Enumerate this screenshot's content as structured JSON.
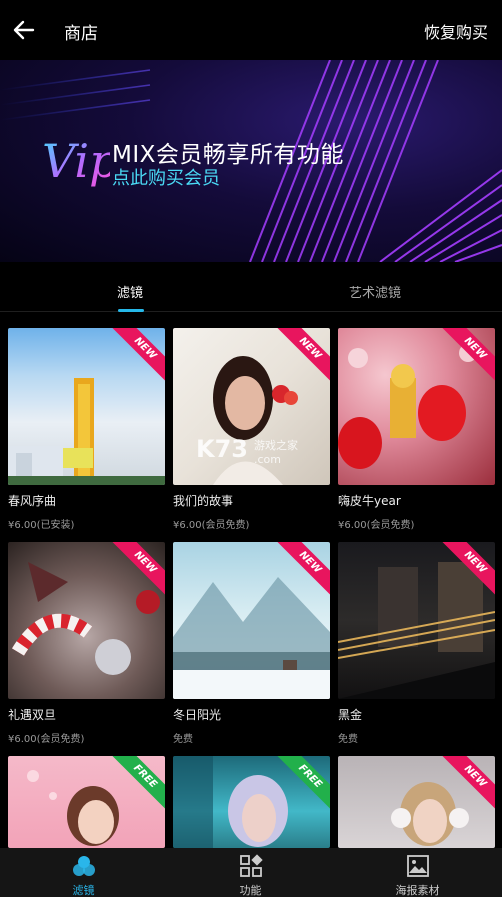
{
  "header": {
    "title": "商店",
    "restore_label": "恢复购买"
  },
  "banner": {
    "logo_text": "Vip",
    "line1": "MIX会员畅享所有功能",
    "line2": "点此购买会员"
  },
  "tabs": [
    {
      "label": "滤镜",
      "active": true
    },
    {
      "label": "艺术滤镜",
      "active": false
    }
  ],
  "items": [
    {
      "name": "春风序曲",
      "price": "¥6.00(已安装)",
      "badge": "NEW"
    },
    {
      "name": "我们的故事",
      "price": "¥6.00(会员免费)",
      "badge": "NEW"
    },
    {
      "name": "嗨皮牛year",
      "price": "¥6.00(会员免费)",
      "badge": "NEW"
    },
    {
      "name": "礼遇双旦",
      "price": "¥6.00(会员免费)",
      "badge": "NEW"
    },
    {
      "name": "冬日阳光",
      "price": "免费",
      "badge": "NEW"
    },
    {
      "name": "黑金",
      "price": "免费",
      "badge": "NEW"
    },
    {
      "name": "",
      "price": "",
      "badge": "FREE"
    },
    {
      "name": "",
      "price": "",
      "badge": "FREE"
    },
    {
      "name": "",
      "price": "",
      "badge": "NEW"
    }
  ],
  "watermark": {
    "logo": "K73",
    "line1": "游戏之家",
    "line2": ".com"
  },
  "bottom_nav": [
    {
      "label": "滤镜",
      "icon": "filter-icon",
      "active": true
    },
    {
      "label": "功能",
      "icon": "grid-icon",
      "active": false
    },
    {
      "label": "海报素材",
      "icon": "image-icon",
      "active": false
    }
  ],
  "colors": {
    "accent": "#26b8e8",
    "new_badge": "#e8155e",
    "free_badge": "#22b04b",
    "background": "#000000"
  }
}
